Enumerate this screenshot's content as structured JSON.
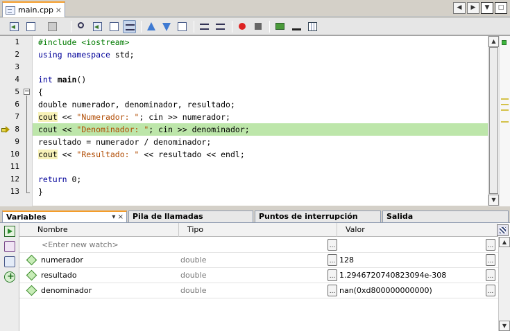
{
  "editor_tab": {
    "filename": "main.cpp",
    "close_glyph": "×"
  },
  "window_nav": {
    "prev_glyph": "◀",
    "next_glyph": "▶",
    "list_glyph": "▼",
    "restore_glyph": "□"
  },
  "toolbar": {
    "icons": [
      "last-edit-icon",
      "back-icon",
      "forward-icon",
      "find-selection-icon",
      "find-previous-icon",
      "find-next-icon",
      "toggle-highlight-icon",
      "step-out-icon",
      "step-into-icon",
      "step-over-icon",
      "shift-left-icon",
      "shift-right-icon",
      "toggle-breakpoint-icon",
      "stop-macro-icon",
      "comment-icon",
      "uncomment-icon",
      "diff-icon"
    ]
  },
  "editor": {
    "line_numbers": [
      "1",
      "2",
      "3",
      "4",
      "5",
      "6",
      "7",
      "8",
      "9",
      "10",
      "11",
      "12",
      "13"
    ],
    "current_line": 8,
    "line1": {
      "directive": "#include",
      "header": "<iostream>"
    },
    "line2": {
      "kw1": "using",
      "kw2": "namespace",
      "rest": " std;"
    },
    "line4": {
      "type": "int",
      "name": "main",
      "rest": "()"
    },
    "line5": {
      "text": "{"
    },
    "line6": {
      "text": "double numerador, denominador, resultado;"
    },
    "line7": {
      "cout": "cout",
      "op": " << ",
      "str": "\"Numerador: \"",
      "rest": "; cin >> numerador;"
    },
    "line8": {
      "cout": "cout",
      "op": " << ",
      "str": "\"Denominador: \"",
      "rest": "; cin >> denominador;"
    },
    "line9": {
      "text": "resultado = numerador / denominador;"
    },
    "line10": {
      "cout": "cout",
      "op": " << ",
      "str": "\"Resultado: \"",
      "rest": " << resultado << endl;"
    },
    "line12": {
      "kw": "return",
      "rest": " 0;"
    },
    "line13": {
      "text": "}"
    },
    "fold_glyph": "−"
  },
  "panel_tabs": [
    {
      "label": "Variables",
      "controls": "▾  ×"
    },
    {
      "label": "Pila de llamadas"
    },
    {
      "label": "Puntos de interrupción"
    },
    {
      "label": "Salida"
    }
  ],
  "variables": {
    "columns": {
      "name": "Nombre",
      "type": "Tipo",
      "value": "Valor"
    },
    "watch_placeholder": "<Enter new watch>",
    "ellipsis": "...",
    "rows": [
      {
        "name": "numerador",
        "type": "double",
        "value": "128"
      },
      {
        "name": "resultado",
        "type": "double",
        "value": "1.2946720740823094e-308"
      },
      {
        "name": "denominador",
        "type": "double",
        "value": "nan(0xd800000000000)"
      }
    ]
  },
  "scroll": {
    "up_glyph": "▲",
    "down_glyph": "▼"
  }
}
